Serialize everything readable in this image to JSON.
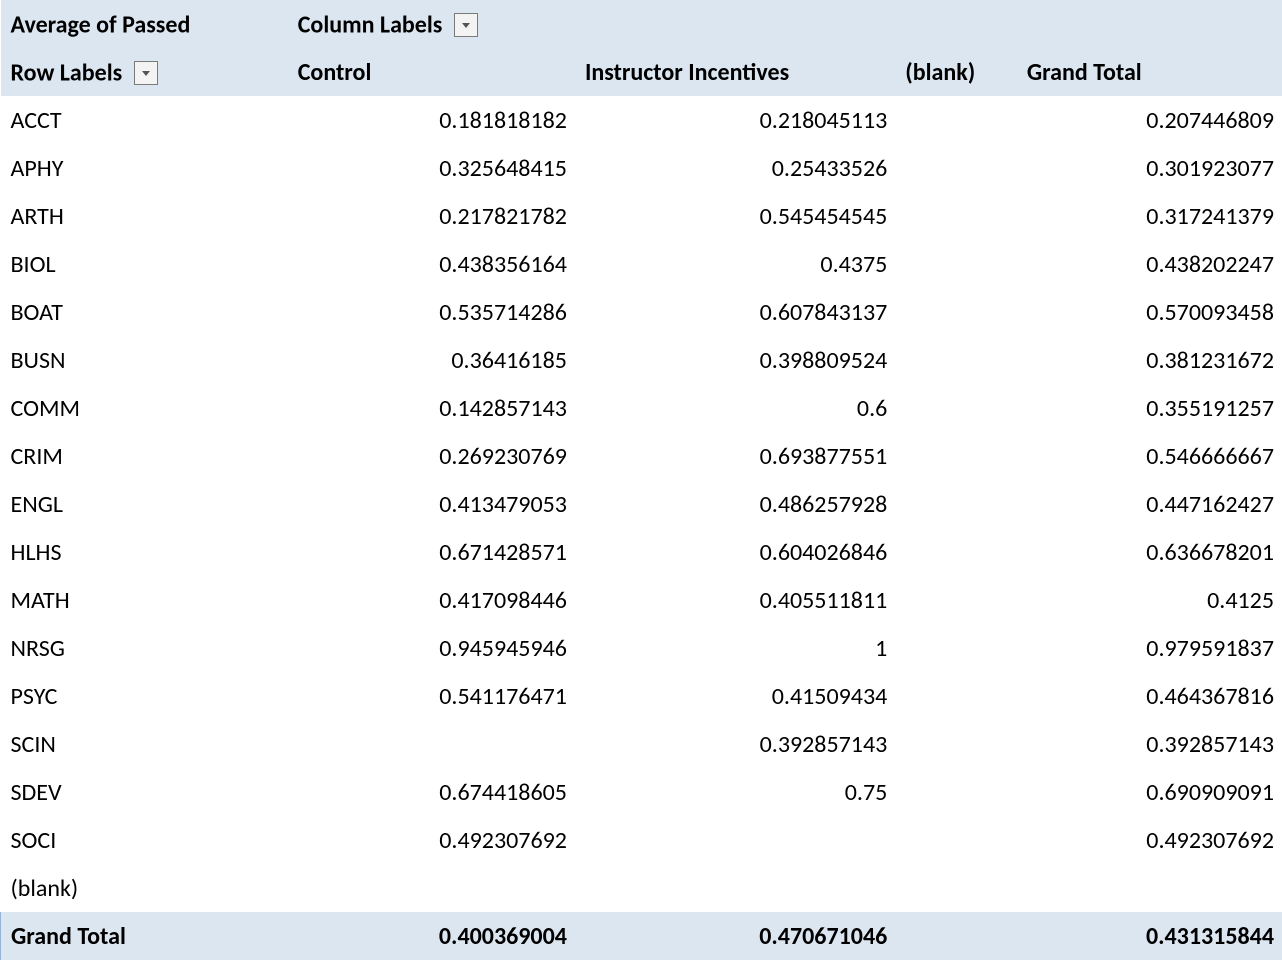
{
  "header": {
    "measure": "Average of Passed",
    "column_labels": "Column Labels",
    "row_labels": "Row Labels",
    "columns": [
      "Control",
      "Instructor Incentives",
      "(blank)",
      "Grand Total"
    ],
    "grand_total_row": "Grand Total"
  },
  "rows": [
    {
      "label": "ACCT",
      "control": "0.181818182",
      "incentives": "0.218045113",
      "blank": "",
      "grand": "0.207446809"
    },
    {
      "label": "APHY",
      "control": "0.325648415",
      "incentives": "0.25433526",
      "blank": "",
      "grand": "0.301923077"
    },
    {
      "label": "ARTH",
      "control": "0.217821782",
      "incentives": "0.545454545",
      "blank": "",
      "grand": "0.317241379"
    },
    {
      "label": "BIOL",
      "control": "0.438356164",
      "incentives": "0.4375",
      "blank": "",
      "grand": "0.438202247"
    },
    {
      "label": "BOAT",
      "control": "0.535714286",
      "incentives": "0.607843137",
      "blank": "",
      "grand": "0.570093458"
    },
    {
      "label": "BUSN",
      "control": "0.36416185",
      "incentives": "0.398809524",
      "blank": "",
      "grand": "0.381231672"
    },
    {
      "label": "COMM",
      "control": "0.142857143",
      "incentives": "0.6",
      "blank": "",
      "grand": "0.355191257"
    },
    {
      "label": "CRIM",
      "control": "0.269230769",
      "incentives": "0.693877551",
      "blank": "",
      "grand": "0.546666667"
    },
    {
      "label": "ENGL",
      "control": "0.413479053",
      "incentives": "0.486257928",
      "blank": "",
      "grand": "0.447162427"
    },
    {
      "label": "HLHS",
      "control": "0.671428571",
      "incentives": "0.604026846",
      "blank": "",
      "grand": "0.636678201"
    },
    {
      "label": "MATH",
      "control": "0.417098446",
      "incentives": "0.405511811",
      "blank": "",
      "grand": "0.4125"
    },
    {
      "label": "NRSG",
      "control": "0.945945946",
      "incentives": "1",
      "blank": "",
      "grand": "0.979591837"
    },
    {
      "label": "PSYC",
      "control": "0.541176471",
      "incentives": "0.41509434",
      "blank": "",
      "grand": "0.464367816"
    },
    {
      "label": "SCIN",
      "control": "",
      "incentives": "0.392857143",
      "blank": "",
      "grand": "0.392857143"
    },
    {
      "label": "SDEV",
      "control": "0.674418605",
      "incentives": "0.75",
      "blank": "",
      "grand": "0.690909091"
    },
    {
      "label": "SOCI",
      "control": "0.492307692",
      "incentives": "",
      "blank": "",
      "grand": "0.492307692"
    },
    {
      "label": "(blank)",
      "control": "",
      "incentives": "",
      "blank": "",
      "grand": ""
    }
  ],
  "grand_total": {
    "control": "0.400369004",
    "incentives": "0.470671046",
    "blank": "",
    "grand": "0.431315844"
  },
  "chart_data": {
    "type": "table",
    "title": "Average of Passed",
    "columns": [
      "Control",
      "Instructor Incentives",
      "(blank)",
      "Grand Total"
    ],
    "categories": [
      "ACCT",
      "APHY",
      "ARTH",
      "BIOL",
      "BOAT",
      "BUSN",
      "COMM",
      "CRIM",
      "ENGL",
      "HLHS",
      "MATH",
      "NRSG",
      "PSYC",
      "SCIN",
      "SDEV",
      "SOCI",
      "(blank)",
      "Grand Total"
    ],
    "series": [
      {
        "name": "Control",
        "values": [
          0.181818182,
          0.325648415,
          0.217821782,
          0.438356164,
          0.535714286,
          0.36416185,
          0.142857143,
          0.269230769,
          0.413479053,
          0.671428571,
          0.417098446,
          0.945945946,
          0.541176471,
          null,
          0.674418605,
          0.492307692,
          null,
          0.400369004
        ]
      },
      {
        "name": "Instructor Incentives",
        "values": [
          0.218045113,
          0.25433526,
          0.545454545,
          0.4375,
          0.607843137,
          0.398809524,
          0.6,
          0.693877551,
          0.486257928,
          0.604026846,
          0.405511811,
          1,
          0.41509434,
          0.392857143,
          0.75,
          null,
          null,
          0.470671046
        ]
      },
      {
        "name": "(blank)",
        "values": [
          null,
          null,
          null,
          null,
          null,
          null,
          null,
          null,
          null,
          null,
          null,
          null,
          null,
          null,
          null,
          null,
          null,
          null
        ]
      },
      {
        "name": "Grand Total",
        "values": [
          0.207446809,
          0.301923077,
          0.317241379,
          0.438202247,
          0.570093458,
          0.381231672,
          0.355191257,
          0.546666667,
          0.447162427,
          0.636678201,
          0.4125,
          0.979591837,
          0.464367816,
          0.392857143,
          0.690909091,
          0.492307692,
          null,
          0.431315844
        ]
      }
    ]
  }
}
